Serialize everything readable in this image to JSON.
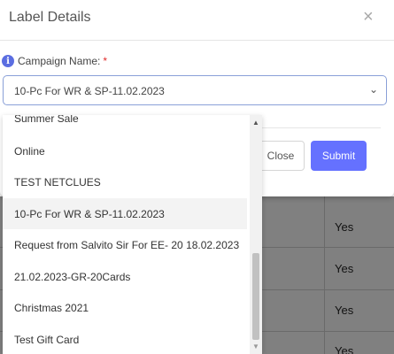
{
  "modal": {
    "title": "Label Details",
    "close_icon": "×",
    "field_label": "Campaign Name:",
    "required_mark": "*",
    "info_icon": "i",
    "selected_value": "10-Pc For WR & SP-11.02.2023",
    "close_button": "Close",
    "submit_button": "Submit"
  },
  "dropdown": {
    "options": [
      "Summer Sale",
      "Online",
      "TEST NETCLUES",
      "10-Pc For WR & SP-11.02.2023",
      "Request from Salvito Sir For EE- 20 18.02.2023",
      "21.02.2023-GR-20Cards",
      "Christmas 2021",
      "Test Gift Card"
    ],
    "selected_index": 3
  },
  "background_table": {
    "cells": [
      "Yes",
      "Yes",
      "Yes",
      "Yes"
    ]
  },
  "colors": {
    "accent": "#6571ff",
    "info": "#5b6ee1",
    "required": "#e02b2b",
    "overlay": "#808080"
  }
}
